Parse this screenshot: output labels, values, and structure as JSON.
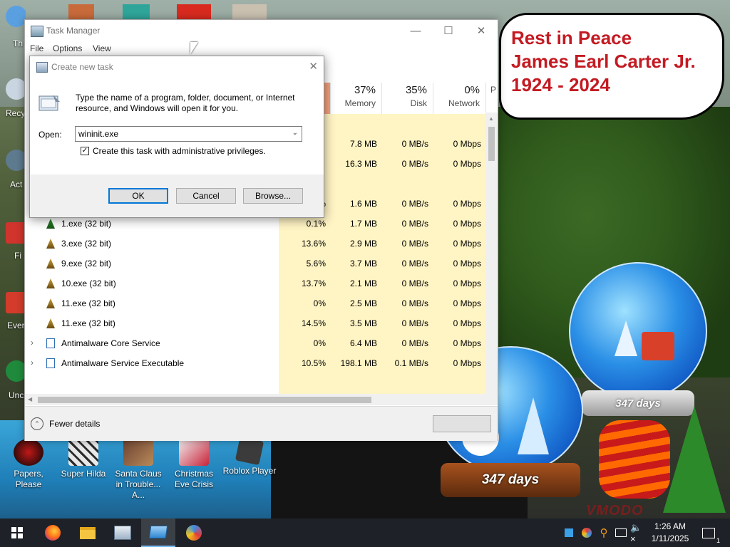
{
  "desktop": {
    "banner_text": "Rest in Peace\nJames Earl Carter Jr.\n1924 - 2024",
    "globe_left_text": "347 days",
    "globe_right_text": "347 days",
    "watermark": "VMODO",
    "left_strip_labels": [
      "Th",
      "Recy",
      "Act",
      "Fi",
      "Ever",
      "Unc"
    ],
    "icons": [
      {
        "label": "Papers, Please",
        "icon": "papers-please-icon"
      },
      {
        "label": "Super Hilda",
        "icon": "super-hilda-icon"
      },
      {
        "label": "Santa Claus in Trouble... A...",
        "icon": "santa-claus-icon"
      },
      {
        "label": "Christmas Eve Crisis",
        "icon": "christmas-eve-icon"
      },
      {
        "label": "Roblox Player",
        "icon": "roblox-icon"
      }
    ]
  },
  "task_manager": {
    "title": "Task Manager",
    "menu": [
      "File",
      "Options",
      "View"
    ],
    "columns": [
      {
        "pct": "37%",
        "label": "Memory"
      },
      {
        "pct": "35%",
        "label": "Disk"
      },
      {
        "pct": "0%",
        "label": "Network"
      },
      {
        "pct": "",
        "label": "P"
      }
    ],
    "rows": [
      {
        "name": "",
        "cpu": "",
        "mem": "",
        "disk": "",
        "net": "",
        "icon": "none"
      },
      {
        "name": "",
        "cpu": "",
        "mem": "7.8 MB",
        "disk": "0 MB/s",
        "net": "0 Mbps",
        "icon": "none"
      },
      {
        "name": "",
        "cpu": "",
        "mem": "16.3 MB",
        "disk": "0 MB/s",
        "net": "0 Mbps",
        "icon": "none"
      },
      {
        "name": "",
        "cpu": "",
        "mem": "",
        "disk": "",
        "net": "",
        "icon": "none"
      },
      {
        "name": "1.exe (32 bit)",
        "cpu": "0.5%",
        "mem": "1.6 MB",
        "disk": "0 MB/s",
        "net": "0 Mbps",
        "icon": "tree-icon"
      },
      {
        "name": "1.exe (32 bit)",
        "cpu": "0.1%",
        "mem": "1.7 MB",
        "disk": "0 MB/s",
        "net": "0 Mbps",
        "icon": "tree-icon"
      },
      {
        "name": "3.exe (32 bit)",
        "cpu": "13.6%",
        "mem": "2.9 MB",
        "disk": "0 MB/s",
        "net": "0 Mbps",
        "icon": "bell-icon"
      },
      {
        "name": "9.exe (32 bit)",
        "cpu": "5.6%",
        "mem": "3.7 MB",
        "disk": "0 MB/s",
        "net": "0 Mbps",
        "icon": "bell-icon"
      },
      {
        "name": "10.exe (32 bit)",
        "cpu": "13.7%",
        "mem": "2.1 MB",
        "disk": "0 MB/s",
        "net": "0 Mbps",
        "icon": "bell-icon"
      },
      {
        "name": "11.exe (32 bit)",
        "cpu": "0%",
        "mem": "2.5 MB",
        "disk": "0 MB/s",
        "net": "0 Mbps",
        "icon": "bell-icon"
      },
      {
        "name": "11.exe (32 bit)",
        "cpu": "14.5%",
        "mem": "3.5 MB",
        "disk": "0 MB/s",
        "net": "0 Mbps",
        "icon": "bell-icon"
      },
      {
        "name": "Antimalware Core Service",
        "cpu": "0%",
        "mem": "6.4 MB",
        "disk": "0 MB/s",
        "net": "0 Mbps",
        "icon": "service-icon",
        "expand": true
      },
      {
        "name": "Antimalware Service Executable",
        "cpu": "10.5%",
        "mem": "198.1 MB",
        "disk": "0.1 MB/s",
        "net": "0 Mbps",
        "icon": "service-icon",
        "expand": true
      }
    ],
    "fewer_details": "Fewer details"
  },
  "create_task_dialog": {
    "title": "Create new task",
    "message": "Type the name of a program, folder, document, or Internet resource, and Windows will open it for you.",
    "open_label": "Open:",
    "open_value": "wininit.exe",
    "checkbox_label": "Create this task with administrative privileges.",
    "checkbox_checked": true,
    "ok_label": "OK",
    "cancel_label": "Cancel",
    "browse_label": "Browse..."
  },
  "taskbar": {
    "time": "1:26 AM",
    "date": "1/11/2025",
    "notification_count": "1",
    "pinned": [
      "start-icon",
      "firefox-icon",
      "file-explorer-icon",
      "task-manager-icon",
      "run-dialog-icon",
      "app-icon"
    ],
    "tray": [
      "tray-app-icon",
      "tray-color-icon",
      "tray-search-icon",
      "network-icon",
      "volume-muted-icon"
    ]
  },
  "colors": {
    "taskbar": "#1e2127",
    "heat_strong": "#ffe08a",
    "heat_light": "#fff4c4",
    "banner_text": "#c41a22"
  }
}
